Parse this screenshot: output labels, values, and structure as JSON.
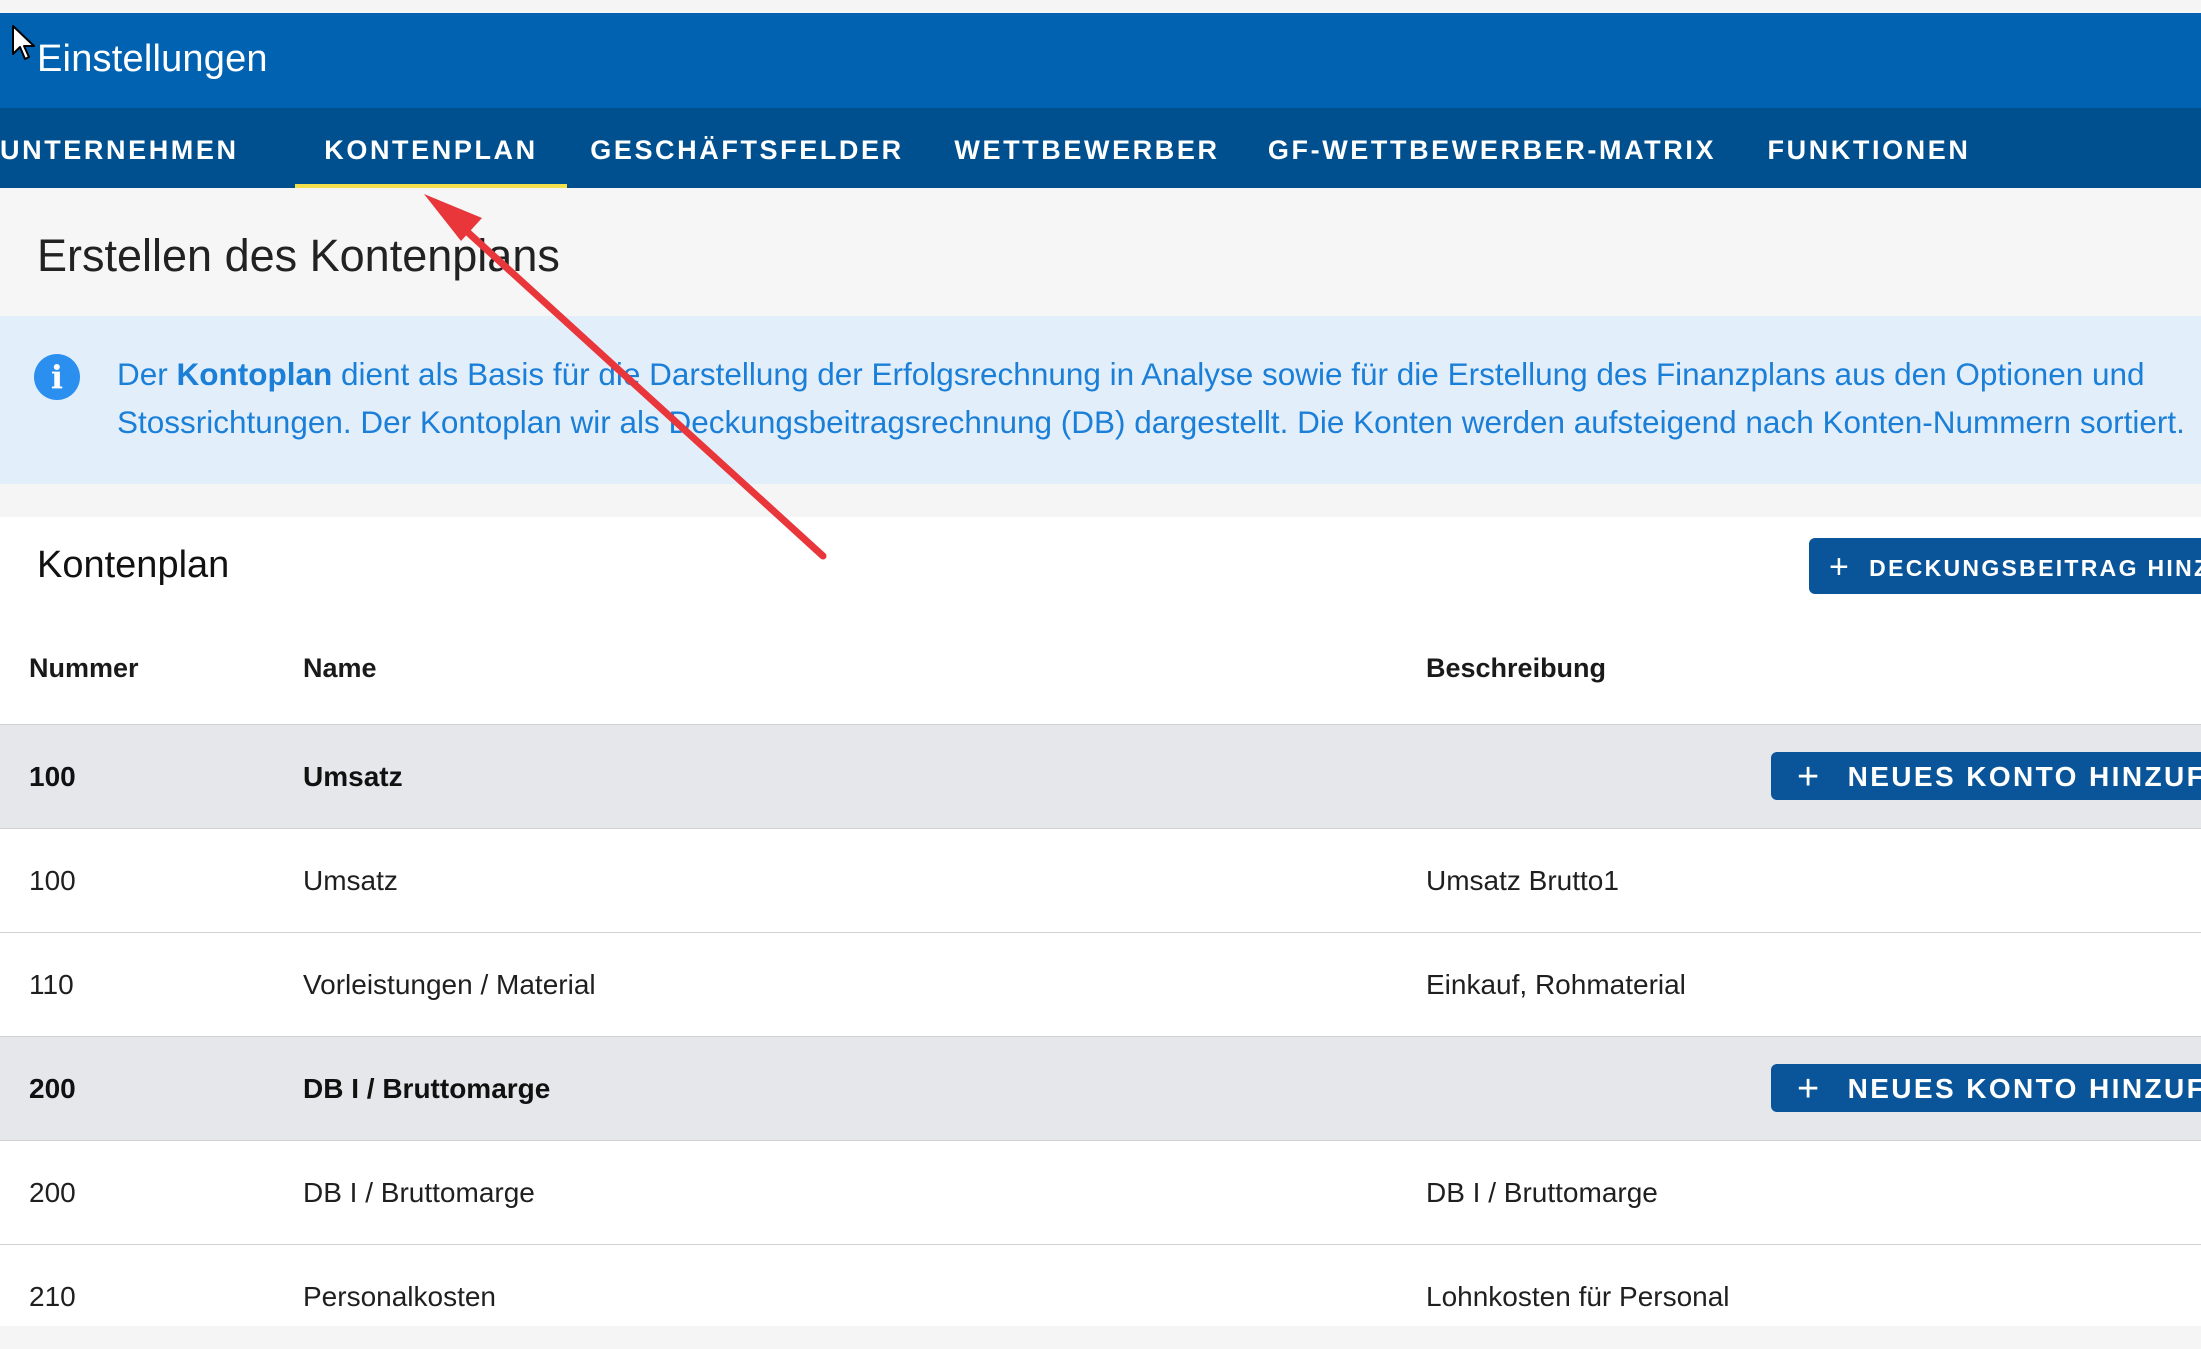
{
  "window": {
    "title": "Einstellungen"
  },
  "tabs": [
    {
      "label": "UNTERNEHMEN",
      "active": false
    },
    {
      "label": "KONTENPLAN",
      "active": true
    },
    {
      "label": "GESCHÄFTSFELDER",
      "active": false
    },
    {
      "label": "WETTBEWERBER",
      "active": false
    },
    {
      "label": "GF-WETTBEWERBER-MATRIX",
      "active": false
    },
    {
      "label": "FUNKTIONEN",
      "active": false
    }
  ],
  "page": {
    "heading": "Erstellen des Kontenplans"
  },
  "info": {
    "icon": "info-icon",
    "line1_prefix": "Der ",
    "line1_bold": "Kontoplan",
    "line1_rest": " dient als Basis für die Darstellung der Erfolgsrechnung in Analyse sowie für die Erstellung des Finanzplans aus den Optionen und",
    "line2": "Stossrichtungen. Der Kontoplan wir als Deckungsbeitragsrechnung (DB) dargestellt. Die Konten werden aufsteigend nach Konten-Nummern sortiert."
  },
  "kontenplan": {
    "title": "Kontenplan",
    "add_db_label": "DECKUNGSBEITRAG HINZUFÜGEN",
    "add_account_label": "NEUES KONTO HINZUFÜGEN",
    "columns": {
      "nummer": "Nummer",
      "name": "Name",
      "beschreibung": "Beschreibung"
    },
    "rows": [
      {
        "type": "group",
        "nummer": "100",
        "name": "Umsatz",
        "beschreibung": ""
      },
      {
        "type": "account",
        "nummer": "100",
        "name": "Umsatz",
        "beschreibung": "Umsatz Brutto1"
      },
      {
        "type": "account",
        "nummer": "110",
        "name": "Vorleistungen / Material",
        "beschreibung": "Einkauf, Rohmaterial"
      },
      {
        "type": "group",
        "nummer": "200",
        "name": "DB I / Bruttomarge",
        "beschreibung": ""
      },
      {
        "type": "account",
        "nummer": "200",
        "name": "DB I / Bruttomarge",
        "beschreibung": "DB I / Bruttomarge"
      },
      {
        "type": "account",
        "nummer": "210",
        "name": "Personalkosten",
        "beschreibung": "Lohnkosten für Personal"
      }
    ]
  },
  "colors": {
    "titlebar": "#0062b0",
    "tabbar": "#00508f",
    "active_tab_underline": "#f4e04d",
    "info_background": "#e2effa",
    "info_text": "#1b7fd8",
    "primary_button": "#0a5599",
    "group_row": "#e5e7eb",
    "annotation_arrow": "#e8363b"
  }
}
